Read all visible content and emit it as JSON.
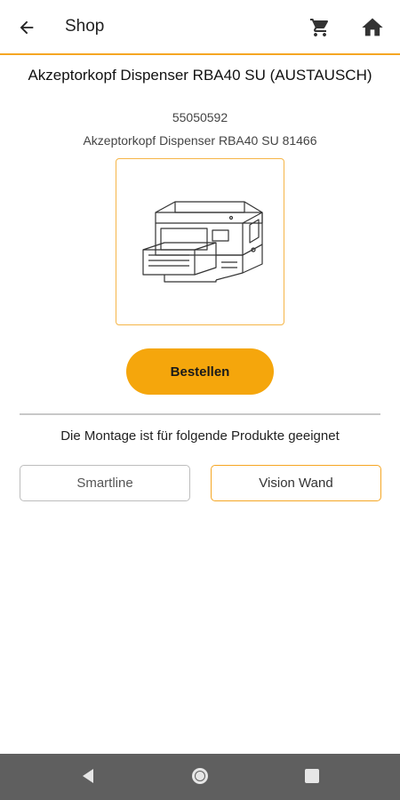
{
  "appbar": {
    "title": "Shop",
    "back_icon": "arrow-left-icon",
    "cart_icon": "shopping-cart-icon",
    "home_icon": "home-icon",
    "accent_color": "#f5a623"
  },
  "product": {
    "title": "Akzeptorkopf Dispenser RBA40 SU (AUSTAUSCH)",
    "number": "55050592",
    "description": "Akzeptorkopf Dispenser RBA40 SU  81466",
    "image_icon": "device-drawing-image"
  },
  "order_button": {
    "label": "Bestellen",
    "color": "#f5a60c"
  },
  "compatibility": {
    "label": "Die Montage ist für folgende Produkte geeignet",
    "options": [
      {
        "label": "Smartline",
        "selected": false
      },
      {
        "label": "Vision Wand",
        "selected": true
      }
    ]
  },
  "system_nav": {
    "back_icon": "nav-back-triangle-icon",
    "home_icon": "nav-home-circle-icon",
    "recent_icon": "nav-recent-square-icon"
  }
}
